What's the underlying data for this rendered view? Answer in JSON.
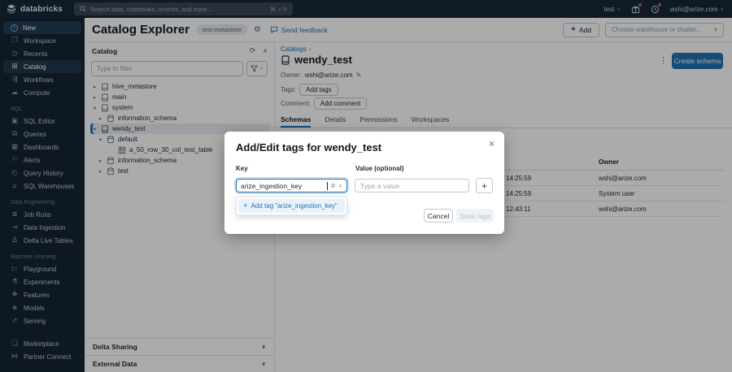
{
  "colors": {
    "accent": "#2272B4",
    "topbar_bg": "#15283a",
    "sidebar_bg": "#142433",
    "notification_dot": "#e0526d"
  },
  "topbar": {
    "brand": "databricks",
    "search_placeholder": "Search data, notebooks, recents, and more...",
    "search_shortcut": "⌘ + P",
    "workspace": "test",
    "user": "wshi@arize.com"
  },
  "sidebar": {
    "groups": [
      {
        "label": "",
        "items": [
          "New",
          "Workspace",
          "Recents",
          "Catalog",
          "Workflows",
          "Compute"
        ]
      },
      {
        "label": "SQL",
        "items": [
          "SQL Editor",
          "Queries",
          "Dashboards",
          "Alerts",
          "Query History",
          "SQL Warehouses"
        ]
      },
      {
        "label": "Data Engineering",
        "items": [
          "Job Runs",
          "Data Ingestion",
          "Delta Live Tables"
        ]
      },
      {
        "label": "Machine Learning",
        "items": [
          "Playground",
          "Experiments",
          "Features",
          "Models",
          "Serving"
        ]
      },
      {
        "label": "",
        "items": [
          "Marketplace",
          "Partner Connect"
        ]
      }
    ]
  },
  "header": {
    "title": "Catalog Explorer",
    "metastore_badge": "test-metastore",
    "send_feedback": "Send feedback",
    "add_button": "Add",
    "warehouse_placeholder": "Choose warehouse or cluster..."
  },
  "catalog_panel": {
    "title": "Catalog",
    "filter_placeholder": "Type to filter",
    "tree": [
      {
        "name": "hive_metastore"
      },
      {
        "name": "main"
      },
      {
        "name": "system"
      },
      {
        "name": "information_schema"
      },
      {
        "name": "wendy_test"
      },
      {
        "name": "default"
      },
      {
        "name": "a_50_row_30_col_test_table"
      },
      {
        "name": "information_schema"
      },
      {
        "name": "test"
      }
    ],
    "sections": [
      "Delta Sharing",
      "External Data"
    ]
  },
  "detail": {
    "breadcrumb": "Catalogs",
    "title": "wendy_test",
    "owner_label": "Owner:",
    "owner": "wshi@arize.com",
    "tags_label": "Tags:",
    "add_tags_button": "Add tags",
    "comment_label": "Comment:",
    "add_comment_button": "Add comment",
    "create_schema_button": "Create schema",
    "tabs": [
      "Schemas",
      "Details",
      "Permissions",
      "Workspaces"
    ],
    "table": {
      "owner_header": "Owner",
      "rows": [
        {
          "time": "14:25:59",
          "owner": "wshi@arize.com"
        },
        {
          "time": "14:25:59",
          "owner": "System user"
        },
        {
          "time": "12:43:11",
          "owner": "wshi@arize.com"
        }
      ]
    }
  },
  "modal": {
    "title": "Add/Edit tags for wendy_test",
    "key_label": "Key",
    "value_label": "Value (optional)",
    "key_value": "arize_ingestion_key",
    "value_placeholder": "Type a value",
    "add_tag_option": "Add tag \"arize_ingestion_key\"",
    "cancel_button": "Cancel",
    "save_button": "Save tags"
  }
}
